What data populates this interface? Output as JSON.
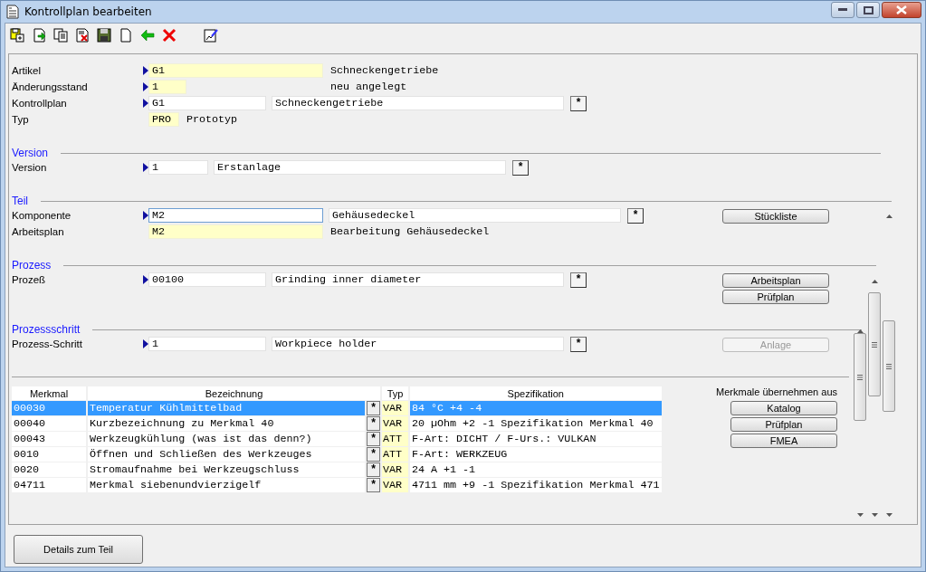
{
  "window": {
    "title": "Kontrollplan bearbeiten"
  },
  "header_rows": [
    {
      "label": "Artikel",
      "required": true,
      "readonly": true,
      "focused": false,
      "code": "G1",
      "description": {
        "kind": "text",
        "value": "Schneckengetriebe"
      },
      "lookup": false
    },
    {
      "label": "Änderungsstand",
      "required": true,
      "readonly": true,
      "focused": false,
      "code": "1",
      "description": {
        "kind": "text",
        "value": "neu angelegt"
      },
      "lookup": false
    },
    {
      "label": "Kontrollplan",
      "required": true,
      "readonly": false,
      "focused": false,
      "code": "G1",
      "description": {
        "kind": "field",
        "value": "Schneckengetriebe"
      },
      "lookup": true
    },
    {
      "label": "Typ",
      "required": false,
      "readonly": true,
      "focused": false,
      "code": "PRO",
      "description": {
        "kind": "text",
        "value": "Prototyp"
      },
      "lookup": false
    }
  ],
  "sections": [
    {
      "title": "Version",
      "rows": [
        {
          "label": "Version",
          "required": true,
          "readonly": false,
          "focused": false,
          "code": "1",
          "description": {
            "kind": "field",
            "value": "Erstanlage"
          },
          "lookup": true
        }
      ]
    },
    {
      "title": "Teil",
      "rows": [
        {
          "label": "Komponente",
          "required": true,
          "readonly": false,
          "focused": true,
          "code": "M2",
          "description": {
            "kind": "field",
            "value": "Gehäusedeckel"
          },
          "lookup": true
        },
        {
          "label": "Arbeitsplan",
          "required": false,
          "readonly": true,
          "focused": false,
          "code": "M2",
          "description": {
            "kind": "text",
            "value": "Bearbeitung Gehäusedeckel"
          },
          "lookup": false
        }
      ],
      "buttons": [
        {
          "label": "Stückliste",
          "disabled": false
        }
      ]
    },
    {
      "title": "Prozess",
      "rows": [
        {
          "label": "Prozeß",
          "required": true,
          "readonly": false,
          "focused": false,
          "code": "00100",
          "description": {
            "kind": "field",
            "value": "Grinding inner diameter"
          },
          "lookup": true
        }
      ],
      "buttons": [
        {
          "label": "Arbeitsplan",
          "disabled": false
        },
        {
          "label": "Prüfplan",
          "disabled": false
        }
      ]
    },
    {
      "title": "Prozessschritt",
      "rows": [
        {
          "label": "Prozess-Schritt",
          "required": true,
          "readonly": false,
          "focused": false,
          "code": "1",
          "description": {
            "kind": "field",
            "value": "Workpiece holder"
          },
          "lookup": true
        }
      ],
      "buttons": [
        {
          "label": "Anlage",
          "disabled": true
        }
      ]
    }
  ],
  "table": {
    "columns": [
      "Merkmal",
      "Bezeichnung",
      "Typ",
      "Spezifikation"
    ],
    "rows": [
      {
        "merkmal": "00030",
        "bezeichnung": "Temperatur Kühlmittelbad",
        "typ": "VAR",
        "spezifikation": "84 °C +4 -4",
        "selected": true
      },
      {
        "merkmal": "00040",
        "bezeichnung": "Kurzbezeichnung zu Merkmal 40",
        "typ": "VAR",
        "spezifikation": "20 µOhm +2 -1 Spezifikation Merkmal 40",
        "selected": false
      },
      {
        "merkmal": "00043",
        "bezeichnung": "Werkzeugkühlung (was ist das denn?)",
        "typ": "ATT",
        "spezifikation": "F-Art: DICHT / F-Urs.: VULKAN",
        "selected": false
      },
      {
        "merkmal": "0010",
        "bezeichnung": "Öffnen und Schließen des Werkzeuges",
        "typ": "ATT",
        "spezifikation": "F-Art: WERKZEUG",
        "selected": false
      },
      {
        "merkmal": "0020",
        "bezeichnung": "Stromaufnahme bei Werkzeugschluss",
        "typ": "VAR",
        "spezifikation": "24 A +1 -1",
        "selected": false
      },
      {
        "merkmal": "04711",
        "bezeichnung": "Merkmal siebenundvierzigelf",
        "typ": "VAR",
        "spezifikation": "4711 mm +9 -1 Spezifikation Merkmal 471",
        "selected": false
      }
    ]
  },
  "import_panel": {
    "label": "Merkmale übernehmen aus",
    "buttons": [
      "Katalog",
      "Prüfplan",
      "FMEA"
    ]
  },
  "lookup_symbol": "*",
  "footer_button": "Details zum Teil"
}
